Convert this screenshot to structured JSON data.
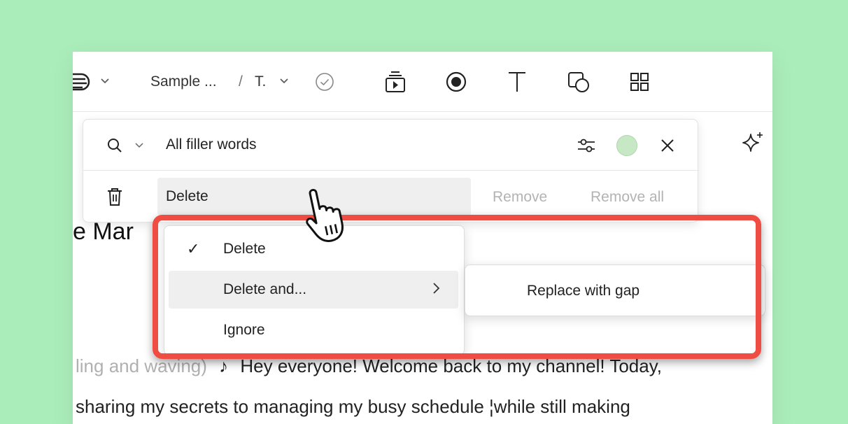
{
  "toolbar": {
    "project_name": "Sample ...",
    "separator": "/",
    "composition": "T."
  },
  "document": {
    "title_fragment": "e Mar"
  },
  "search": {
    "filter_value": "All filler words",
    "accent_color": "#c6e8c4"
  },
  "action_bar": {
    "selected_action": "Delete",
    "remove_label": "Remove",
    "remove_all_label": "Remove all"
  },
  "dropdown": {
    "items": [
      {
        "label": "Delete",
        "checked": true
      },
      {
        "label": "Delete and...",
        "has_submenu": true
      },
      {
        "label": "Ignore"
      }
    ],
    "submenu_items": [
      {
        "label": "Replace with gap"
      }
    ]
  },
  "transcript": {
    "line1_faded": "ling and waving)",
    "line1_music": "♪",
    "line1_text": "Hey everyone! Welcome back to my channel! Today,",
    "line2_text": "sharing my secrets to managing my busy schedule ¦while still making"
  },
  "colors": {
    "background": "#abedba",
    "highlight": "#ef4d44"
  }
}
